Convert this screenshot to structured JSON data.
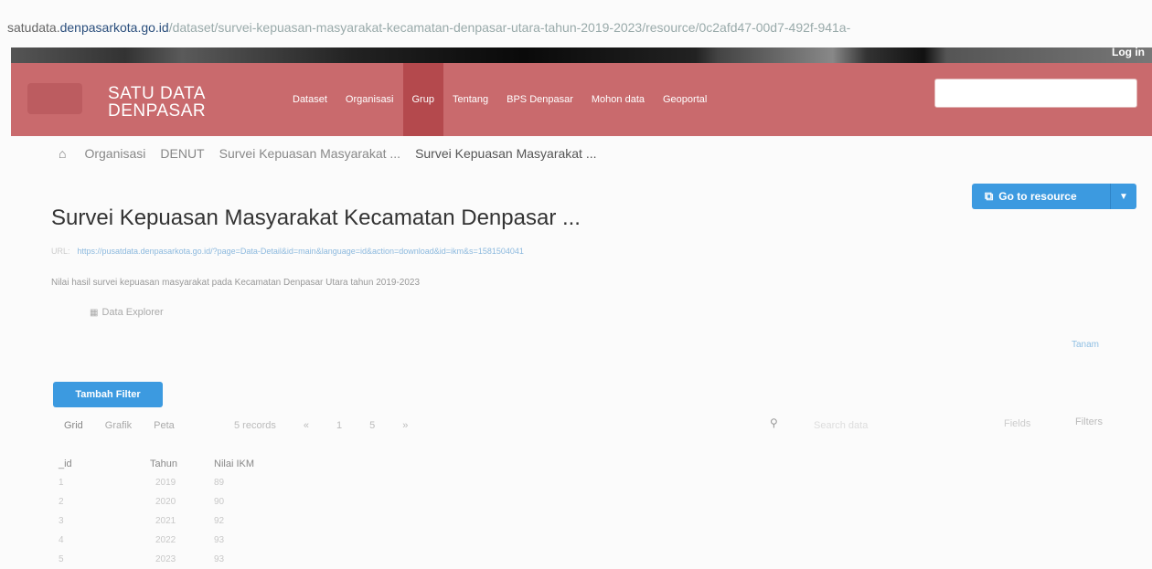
{
  "browser": {
    "url_prefix": "satudata.",
    "url_domain": "denpasarkota.go.id",
    "url_path": "/dataset/survei-kepuasan-masyarakat-kecamatan-denpasar-utara-tahun-2019-2023/resource/0c2afd47-00d7-492f-941a-"
  },
  "topbar": {
    "login": "Log in"
  },
  "brand": {
    "line1": "SATU DATA",
    "line2": "DENPASAR"
  },
  "nav": [
    {
      "label": "Dataset",
      "active": false
    },
    {
      "label": "Organisasi",
      "active": false
    },
    {
      "label": "Grup",
      "active": true
    },
    {
      "label": "Tentang",
      "active": false
    },
    {
      "label": "BPS Denpasar",
      "active": false
    },
    {
      "label": "Mohon data",
      "active": false
    },
    {
      "label": "Geoportal",
      "active": false
    }
  ],
  "breadcrumb": {
    "items": [
      "Organisasi",
      "DENUT",
      "Survei Kepuasan Masyarakat ...",
      "Survei Kepuasan Masyarakat ..."
    ]
  },
  "actions": {
    "go_to_resource": "Go to resource"
  },
  "resource": {
    "title": "Survei Kepuasan Masyarakat Kecamatan Denpasar ...",
    "url_label": "URL:",
    "url": "https://pusatdata.denpasarkota.go.id/?page=Data-Detail&id=main&language=id&action=download&id=ikm&s=1581504041",
    "description": "Nilai hasil survei kepuasan masyarakat pada Kecamatan Denpasar Utara tahun 2019-2023",
    "data_explorer": "Data Explorer",
    "embed": "Tanam"
  },
  "explorer": {
    "add_filter": "Tambah Filter",
    "views": [
      "Grid",
      "Grafik",
      "Peta"
    ],
    "records": "5 records",
    "pager": [
      "«",
      "1",
      "5",
      "»"
    ],
    "search_placeholder": "Search data",
    "fields": "Fields",
    "filters": "Filters",
    "columns": [
      "_id",
      "Tahun",
      "Nilai IKM"
    ],
    "rows": [
      [
        "1",
        "2019",
        "89"
      ],
      [
        "2",
        "2020",
        "90"
      ],
      [
        "3",
        "2021",
        "92"
      ],
      [
        "4",
        "2022",
        "93"
      ],
      [
        "5",
        "2023",
        "93"
      ]
    ]
  },
  "colors": {
    "masthead": "#c96a6d",
    "active_nav": "#b4494d",
    "primary_button": "#3c9ae0"
  },
  "icons": [
    "home-icon",
    "external-link-icon",
    "caret-down-icon",
    "table-icon",
    "search-icon"
  ]
}
